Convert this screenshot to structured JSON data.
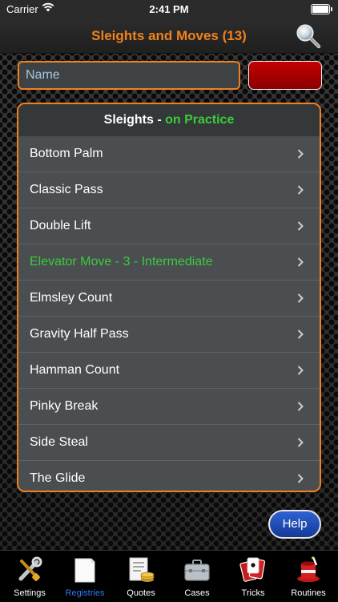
{
  "status_bar": {
    "carrier": "Carrier",
    "time": "2:41 PM"
  },
  "nav": {
    "title": "Sleights and Moves (13)",
    "search_icon": "magnifier-icon"
  },
  "search": {
    "placeholder": "Name",
    "value": ""
  },
  "list": {
    "header_prefix": "Sleights - ",
    "header_accent": "on Practice",
    "items": [
      {
        "label": "Bottom Palm",
        "highlight": false
      },
      {
        "label": "Classic Pass",
        "highlight": false
      },
      {
        "label": "Double Lift",
        "highlight": false
      },
      {
        "label": "Elevator Move - 3 - Intermediate",
        "highlight": true
      },
      {
        "label": "Elmsley Count",
        "highlight": false
      },
      {
        "label": "Gravity Half Pass",
        "highlight": false
      },
      {
        "label": "Hamman Count",
        "highlight": false
      },
      {
        "label": "Pinky Break",
        "highlight": false
      },
      {
        "label": "Side Steal",
        "highlight": false
      },
      {
        "label": "The Glide",
        "highlight": false
      }
    ]
  },
  "help": {
    "label": "Help"
  },
  "tabs": [
    {
      "label": "Settings",
      "icon": "tools-icon",
      "active": false
    },
    {
      "label": "Registries",
      "icon": "paper-icon",
      "active": true
    },
    {
      "label": "Quotes",
      "icon": "invoice-coins-icon",
      "active": false
    },
    {
      "label": "Cases",
      "icon": "briefcase-icon",
      "active": false
    },
    {
      "label": "Tricks",
      "icon": "playing-cards-icon",
      "active": false
    },
    {
      "label": "Routines",
      "icon": "magic-hat-icon",
      "active": false
    }
  ],
  "colors": {
    "accent_orange": "#f0821e",
    "highlight_green": "#3ccb3c",
    "active_tab_blue": "#2f7cf6",
    "panel": "#4a4e51"
  }
}
